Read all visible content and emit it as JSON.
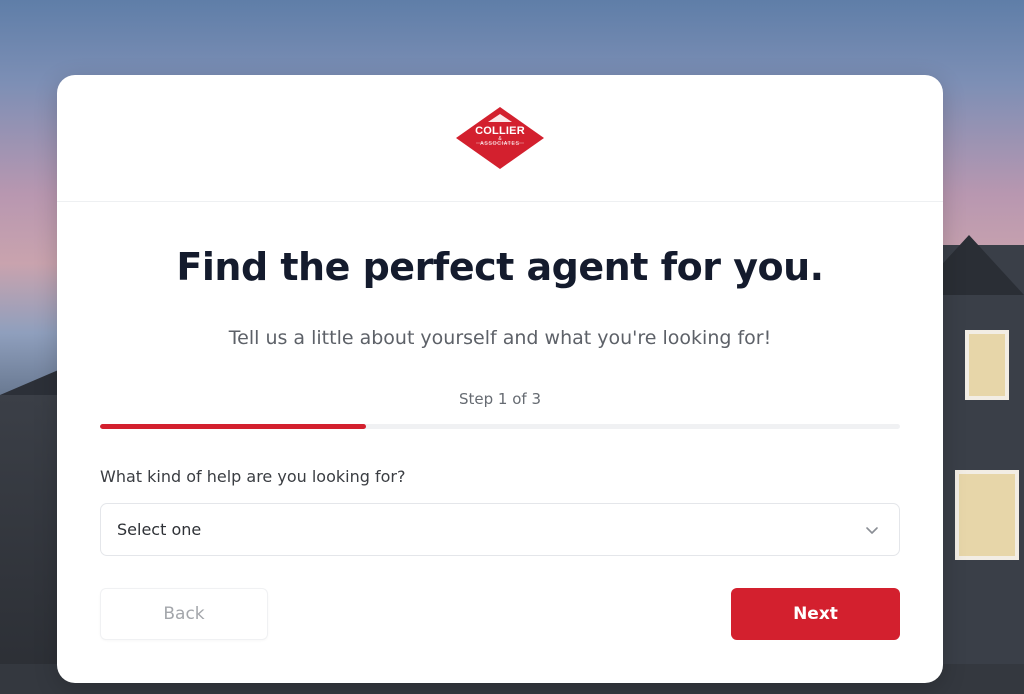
{
  "brand": {
    "logo_name": "COLLIER",
    "logo_amp": "&",
    "logo_sub": "ASSOCIATES",
    "accent_color": "#d3202e"
  },
  "form": {
    "headline": "Find the perfect agent for you.",
    "subline": "Tell us a little about yourself and what you're looking for!",
    "step_text": "Step 1 of 3",
    "progress_fraction": 0.333,
    "question": "What kind of help are you looking for?",
    "select": {
      "selected_value": "Select one",
      "icon": "chevron-down-icon"
    },
    "back_label": "Back",
    "next_label": "Next"
  }
}
